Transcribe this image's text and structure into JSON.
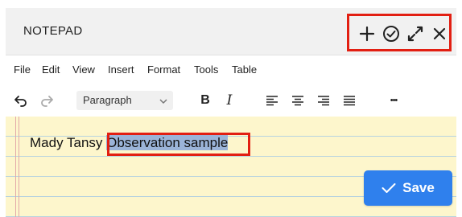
{
  "app": {
    "title": "NOTEPAD"
  },
  "window_controls": [
    {
      "name": "add",
      "icon": "plus-icon"
    },
    {
      "name": "check",
      "icon": "check-circle-icon"
    },
    {
      "name": "expand",
      "icon": "expand-icon"
    },
    {
      "name": "close",
      "icon": "close-icon"
    }
  ],
  "menu": [
    "File",
    "Edit",
    "View",
    "Insert",
    "Format",
    "Tools",
    "Table"
  ],
  "toolbar": {
    "undo_icon": "undo-icon",
    "redo_icon": "redo-icon",
    "paragraph_style": "Paragraph",
    "bold_label": "B",
    "italic_label": "I",
    "align_icons": [
      "align-left-icon",
      "align-center-icon",
      "align-right-icon",
      "align-justify-icon"
    ],
    "more_label": "•••"
  },
  "note": {
    "plain_text": "Mady Tansy ",
    "selected_text": "Observation sample"
  },
  "save_button": {
    "label": "Save",
    "icon": "check-icon"
  },
  "colors": {
    "paper": "#fdf6cc",
    "ruled_line": "#b8d3df",
    "selection": "#9bb4d8",
    "save_button": "#2f80ed",
    "annotation_box": "#e21f12"
  }
}
